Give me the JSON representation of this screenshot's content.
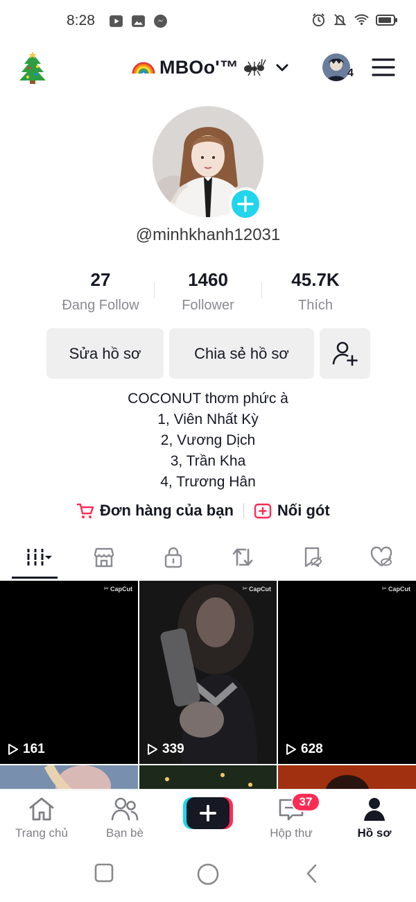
{
  "status_bar": {
    "time": "8:28"
  },
  "header": {
    "title": "MBOo'™",
    "account_count": "4"
  },
  "profile": {
    "username": "@minhkhanh12031"
  },
  "stats": [
    {
      "value": "27",
      "label": "Đang Follow"
    },
    {
      "value": "1460",
      "label": "Follower"
    },
    {
      "value": "45.7K",
      "label": "Thích"
    }
  ],
  "actions": {
    "edit_label": "Sửa hồ sơ",
    "share_label": "Chia sẻ hồ sơ"
  },
  "bio": {
    "lines": [
      "COCONUT thơm phức à",
      "1, Viên Nhất Kỳ",
      "2, Vương Dịch",
      "3, Trần Kha",
      "4, Trương Hân"
    ]
  },
  "links": {
    "orders": "Đơn hàng của bạn",
    "tip": "Nối gót"
  },
  "videos": [
    {
      "views": "161",
      "watermark": "CapCut"
    },
    {
      "views": "339",
      "watermark": "CapCut"
    },
    {
      "views": "628",
      "watermark": "CapCut"
    }
  ],
  "bottom_nav": {
    "home": "Trang chủ",
    "friends": "Bạn bè",
    "inbox": "Hộp thư",
    "inbox_badge": "37",
    "profile": "Hồ sơ"
  },
  "colors": {
    "accent": "#fe2c55",
    "cyan": "#20d5ec",
    "text": "#161823",
    "muted": "#8a8b91"
  }
}
